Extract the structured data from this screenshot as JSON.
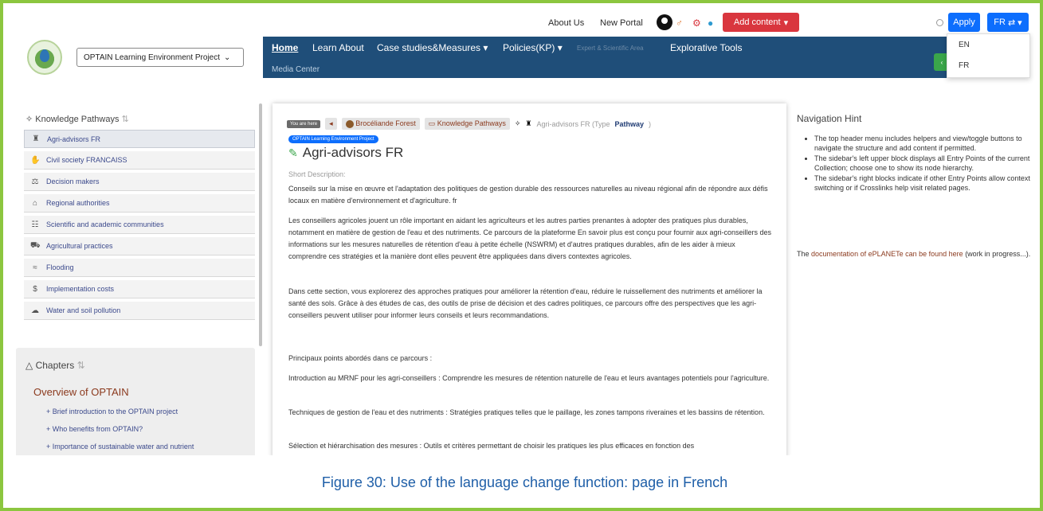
{
  "topbar": {
    "about_us": "About Us",
    "new_portal": "New Portal",
    "add_content": "Add content",
    "apply": "Apply",
    "lang_current": "FR",
    "lang_options": [
      "EN",
      "FR"
    ]
  },
  "header": {
    "project_select": "OPTAIN Learning Environment Project",
    "nav": {
      "home": "Home",
      "learn_about": "Learn About",
      "case_studies": "Case studies&Measures",
      "policies": "Policies(KP)",
      "expert": "Expert & Scientific Area",
      "explorative": "Explorative Tools",
      "media_center": "Media Center"
    }
  },
  "sidebar": {
    "kp_title": "Knowledge Pathways",
    "items": [
      {
        "label": "Agri-advisors FR",
        "icon": "farmer-icon"
      },
      {
        "label": "Civil society FRANCAISS",
        "icon": "handshake-icon"
      },
      {
        "label": "Decision makers",
        "icon": "scales-icon"
      },
      {
        "label": "Regional authorities",
        "icon": "building-icon"
      },
      {
        "label": "Scientific and academic communities",
        "icon": "people-icon"
      },
      {
        "label": "Agricultural practices",
        "icon": "tractor-icon"
      },
      {
        "label": "Flooding",
        "icon": "water-icon"
      },
      {
        "label": "Implementation costs",
        "icon": "coins-icon"
      },
      {
        "label": "Water and soil pollution",
        "icon": "pollution-icon"
      }
    ],
    "chapters_title": "Chapters",
    "overview": "Overview of OPTAIN",
    "chapter_items": [
      "Brief introduction to the OPTAIN project",
      "Who benefits from OPTAIN?",
      "Importance of sustainable water and nutrient"
    ]
  },
  "content": {
    "you_are_here": "You are here",
    "crumb_forest": "Brocéliande Forest",
    "crumb_kp": "Knowledge Pathways",
    "crumb_current": "Agri-advisors FR (Type",
    "crumb_type": "Pathway",
    "crumb_close": ")",
    "badge": "OPTAIN Learning Environment Project",
    "title": "Agri-advisors FR",
    "short_label": "Short Description:",
    "paragraphs": [
      "Conseils sur la mise en œuvre et l'adaptation des politiques de gestion durable des ressources naturelles au niveau régional afin de répondre aux défis locaux en matière d'environnement et d'agriculture. fr",
      "Les conseillers agricoles jouent un rôle important en aidant les agriculteurs et les autres parties prenantes à adopter des pratiques plus durables, notamment en matière de gestion de l'eau et des nutriments. Ce parcours de la plateforme En savoir plus est conçu pour fournir aux agri-conseillers des informations sur les mesures naturelles de rétention d'eau à petite échelle (NSWRM) et d'autres pratiques durables, afin de les aider à mieux comprendre ces stratégies et la manière dont elles peuvent être appliquées dans divers contextes agricoles.",
      "Dans cette section, vous explorerez des approches pratiques pour améliorer la rétention d'eau, réduire le ruissellement des nutriments et améliorer la santé des sols. Grâce à des études de cas, des outils de prise de décision et des cadres politiques, ce parcours offre des perspectives que les agri-conseillers peuvent utiliser pour informer leurs conseils et leurs recommandations.",
      "Principaux points abordés dans ce parcours :",
      "Introduction au MRNF pour les agri-conseillers : Comprendre les mesures de rétention naturelle de l'eau et leurs avantages potentiels pour l'agriculture.",
      "Techniques de gestion de l'eau et des nutriments : Stratégies pratiques telles que le paillage, les zones tampons riveraines et les bassins de rétention.",
      "Sélection et hiérarchisation des mesures : Outils et critères permettant de choisir les pratiques les plus efficaces en fonction des"
    ]
  },
  "hint": {
    "title": "Navigation Hint",
    "items": [
      "The top header menu includes helpers and view/toggle buttons to navigate the structure and add content if permitted.",
      "The sidebar's left upper block displays all Entry Points of the current Collection; choose one to show its node hierarchy.",
      "The sidebar's right blocks indicate if other Entry Points allow context switching or if Crosslinks help visit related pages."
    ],
    "doc_prefix": "The",
    "doc_link": "documentation of ePLANETe can be found here",
    "doc_suffix": "(work in progress...)."
  },
  "caption": "Figure 30: Use of the language change function: page in French",
  "colors": {
    "frame": "#8cc63f",
    "nav": "#1f4e79",
    "add_btn": "#d9363e",
    "apply_btn": "#0d6efd",
    "caption": "#1f5fa8"
  }
}
